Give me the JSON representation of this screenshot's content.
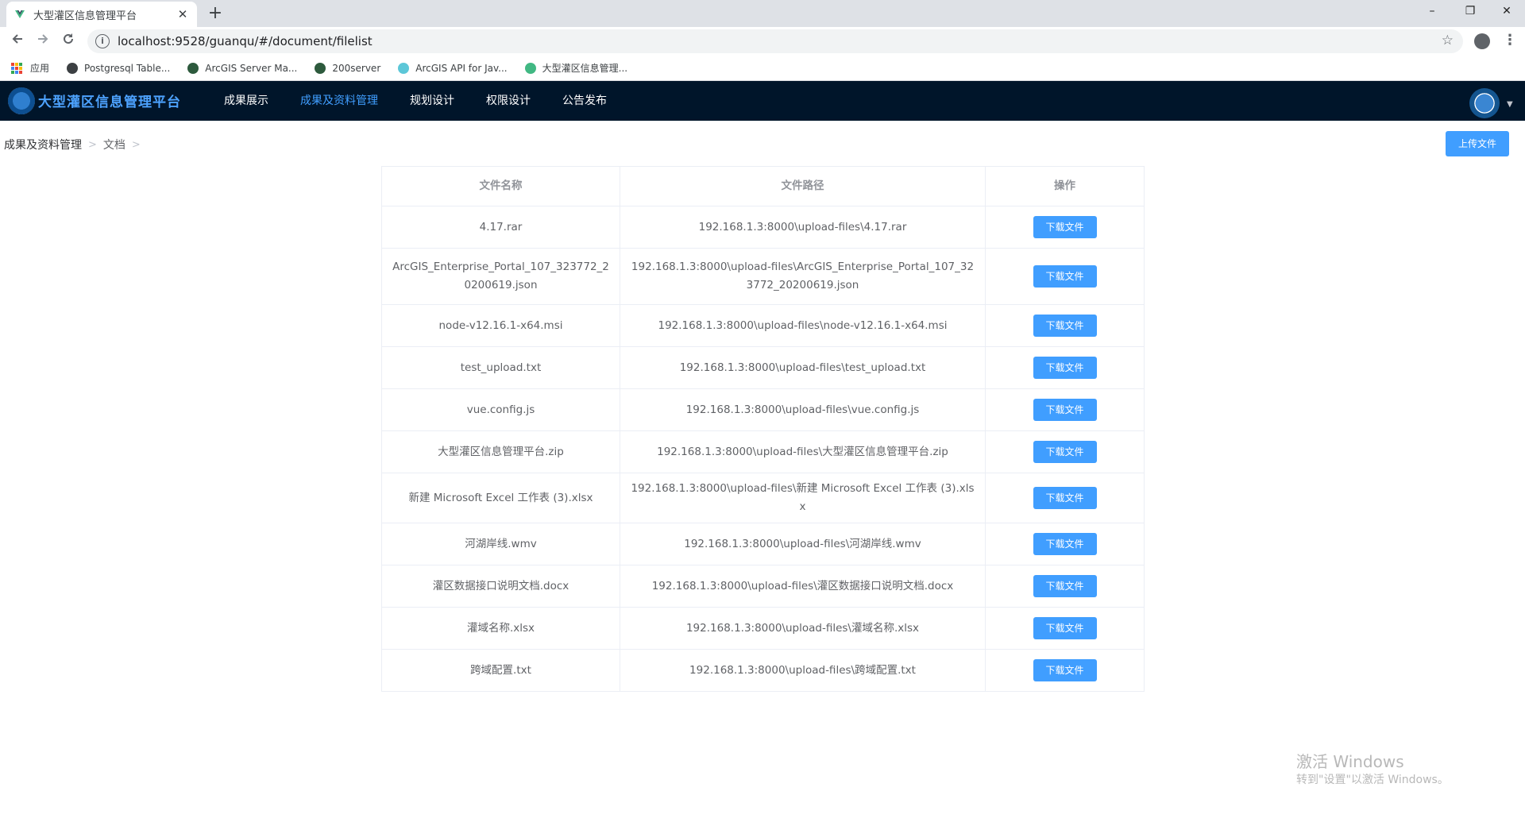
{
  "browser": {
    "tab_title": "大型灌区信息管理平台",
    "tab_close": "✕",
    "new_tab": "+",
    "url": "localhost:9528/guanqu/#/document/filelist",
    "window_controls": [
      "–",
      "❐",
      "✕"
    ],
    "bookmarks": [
      {
        "label": "应用",
        "icon": "apps-grid-icon"
      },
      {
        "label": "Postgresql Table...",
        "icon": "globe-icon"
      },
      {
        "label": "ArcGIS Server Ma...",
        "icon": "globe-icon"
      },
      {
        "label": "200server",
        "icon": "globe-icon"
      },
      {
        "label": "ArcGIS API for Jav...",
        "icon": "arcgis-icon"
      },
      {
        "label": "大型灌区信息管理...",
        "icon": "vue-icon"
      }
    ]
  },
  "app": {
    "brand": "大型灌区信息管理平台",
    "menu": [
      {
        "label": "成果展示",
        "active": false
      },
      {
        "label": "成果及资料管理",
        "active": true
      },
      {
        "label": "规划设计",
        "active": false
      },
      {
        "label": "权限设计",
        "active": false
      },
      {
        "label": "公告发布",
        "active": false
      }
    ]
  },
  "breadcrumb": {
    "items": [
      "成果及资料管理",
      "文档"
    ],
    "separator": ">"
  },
  "upload_button": "上传文件",
  "table": {
    "headers": [
      "文件名称",
      "文件路径",
      "操作"
    ],
    "download_label": "下载文件",
    "rows": [
      {
        "name": "4.17.rar",
        "path": "192.168.1.3:8000\\upload-files\\4.17.rar"
      },
      {
        "name": "ArcGIS_Enterprise_Portal_107_323772_20200619.json",
        "path": "192.168.1.3:8000\\upload-files\\ArcGIS_Enterprise_Portal_107_323772_20200619.json"
      },
      {
        "name": "node-v12.16.1-x64.msi",
        "path": "192.168.1.3:8000\\upload-files\\node-v12.16.1-x64.msi"
      },
      {
        "name": "test_upload.txt",
        "path": "192.168.1.3:8000\\upload-files\\test_upload.txt"
      },
      {
        "name": "vue.config.js",
        "path": "192.168.1.3:8000\\upload-files\\vue.config.js"
      },
      {
        "name": "大型灌区信息管理平台.zip",
        "path": "192.168.1.3:8000\\upload-files\\大型灌区信息管理平台.zip"
      },
      {
        "name": "新建 Microsoft Excel 工作表 (3).xlsx",
        "path": "192.168.1.3:8000\\upload-files\\新建 Microsoft Excel 工作表 (3).xlsx"
      },
      {
        "name": "河湖岸线.wmv",
        "path": "192.168.1.3:8000\\upload-files\\河湖岸线.wmv"
      },
      {
        "name": "灌区数据接口说明文档.docx",
        "path": "192.168.1.3:8000\\upload-files\\灌区数据接口说明文档.docx"
      },
      {
        "name": "灌域名称.xlsx",
        "path": "192.168.1.3:8000\\upload-files\\灌域名称.xlsx"
      },
      {
        "name": "跨域配置.txt",
        "path": "192.168.1.3:8000\\upload-files\\跨域配置.txt"
      }
    ]
  },
  "watermark": {
    "line1": "激活 Windows",
    "line2": "转到\"设置\"以激活 Windows。"
  },
  "colors": {
    "header_bg": "#00152a",
    "accent": "#409eff",
    "brand_text": "#4da3ff"
  }
}
